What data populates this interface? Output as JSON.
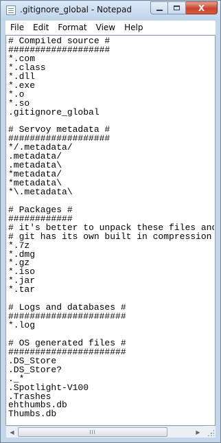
{
  "window": {
    "title": ".gitignore_global - Notepad",
    "min_glyph": "",
    "max_glyph": "",
    "close_glyph": "X"
  },
  "menu": {
    "items": [
      "File",
      "Edit",
      "Format",
      "View",
      "Help"
    ]
  },
  "document": {
    "lines": [
      "# Compiled source #",
      "###################",
      "*.com",
      "*.class",
      "*.dll",
      "*.exe",
      "*.o",
      "*.so",
      ".gitignore_global",
      "",
      "# Servoy metadata #",
      "###################",
      "*/.metadata/",
      ".metadata/",
      ".metadata\\",
      "*metadata/",
      "*metadata\\",
      "*\\.metadata\\",
      "",
      "# Packages #",
      "############",
      "# it's better to unpack these files and commit the raw source",
      "# git has its own built in compression methods",
      "*.7z",
      "*.dmg",
      "*.gz",
      "*.iso",
      "*.jar",
      "*.tar",
      "",
      "# Logs and databases #",
      "######################",
      "*.log",
      "",
      "# OS generated files #",
      "######################",
      ".DS_Store",
      ".DS_Store?",
      "._*",
      ".Spotlight-V100",
      ".Trashes",
      "ehthumbs.db",
      "Thumbs.db"
    ]
  },
  "scrollbar": {
    "left_arrow": "◀",
    "right_arrow": "▶"
  }
}
